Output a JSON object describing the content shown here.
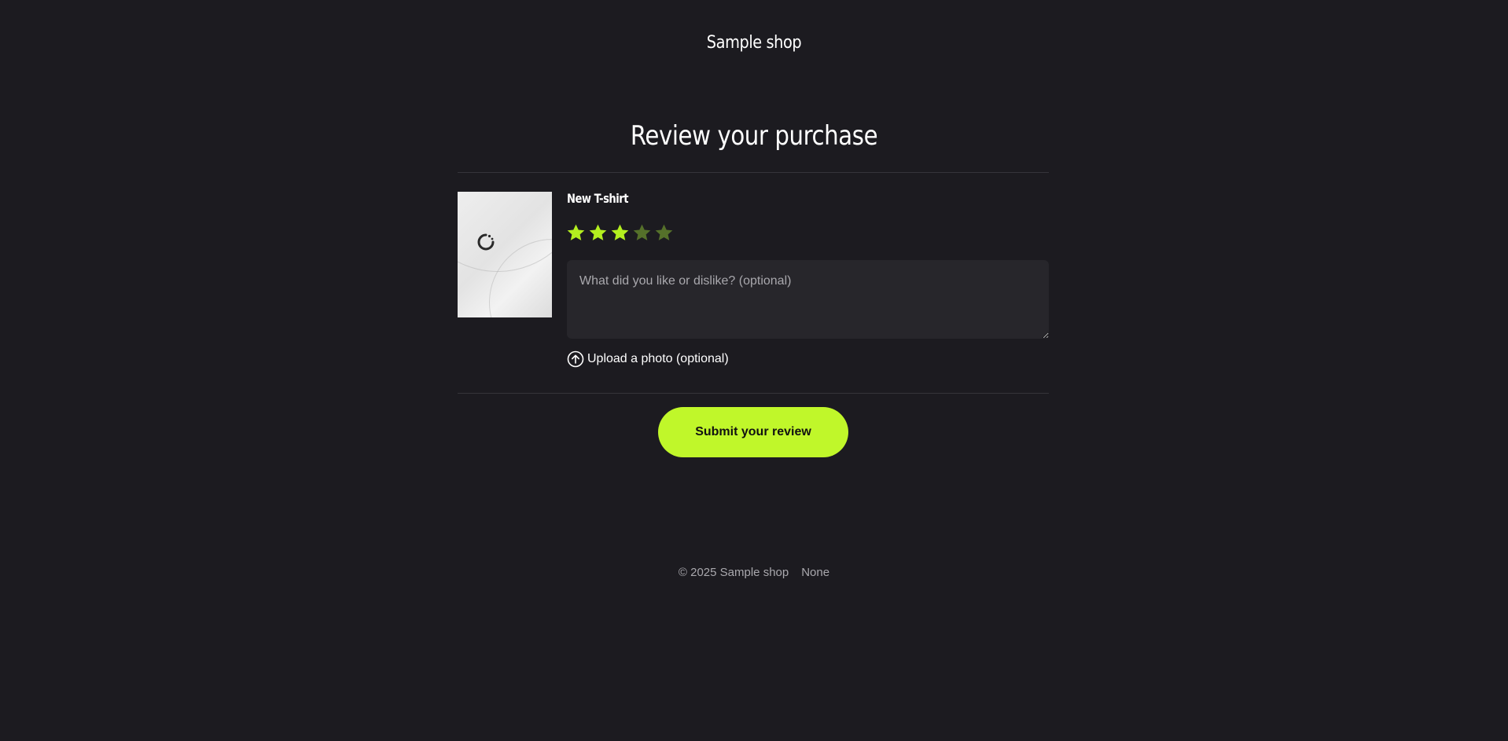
{
  "header": {
    "shop_name": "Sample shop"
  },
  "main": {
    "title": "Review your purchase",
    "product": {
      "name": "New T-shirt",
      "image_alt": "T-shirt product image"
    },
    "rating": {
      "value": 3,
      "max": 5
    },
    "review": {
      "placeholder": "What did you like or dislike? (optional)",
      "value": ""
    },
    "upload": {
      "label": "Upload a photo (optional)"
    },
    "submit": {
      "label": "Submit your review"
    }
  },
  "footer": {
    "copyright": "© 2025 Sample shop",
    "extra": "None"
  },
  "colors": {
    "background": "#1c1b20",
    "accent": "#c0f72a",
    "star_filled": "#b4ef1f",
    "star_empty": "#55702a",
    "input_bg": "#27262b",
    "muted_text": "#a9a8ad",
    "divider": "#35343a"
  },
  "icons": {
    "star": "star-icon",
    "upload": "upload-arrow-circle-icon",
    "loading": "loading-spinner-icon"
  }
}
